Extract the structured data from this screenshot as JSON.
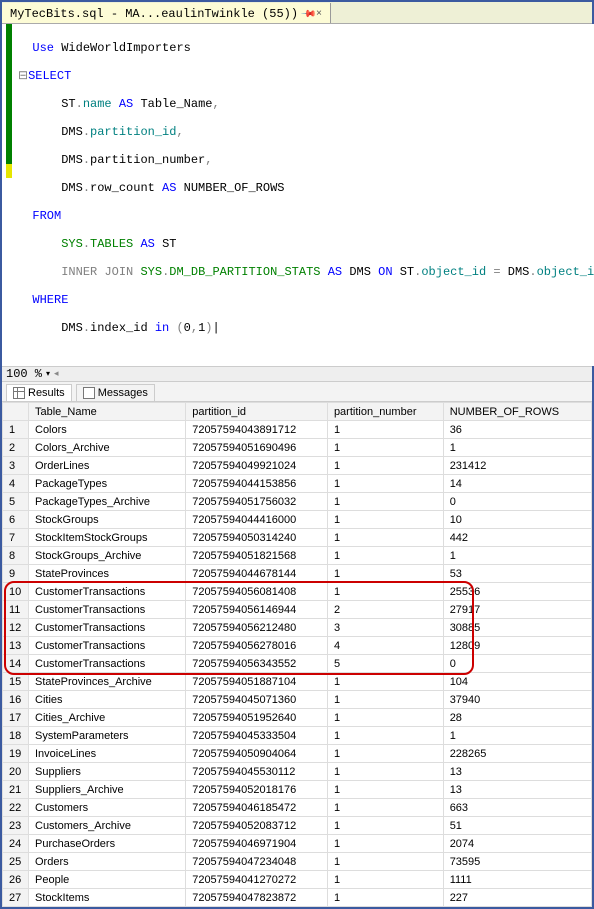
{
  "tab": {
    "title": "MyTecBits.sql - MA...eaulinTwinkle (55))",
    "close": "×"
  },
  "zoom": {
    "value": "100 %"
  },
  "result_tabs": {
    "results": "Results",
    "messages": "Messages"
  },
  "sql": {
    "l1_use": "Use",
    "l1_db": "WideWorldImporters",
    "l2_select": "SELECT",
    "l3_alias": "ST",
    "l3_dot": ".",
    "l3_name": "name",
    "l3_as": "AS",
    "l3_tbl": "Table_Name",
    "l3_c": ",",
    "l4_alias": "DMS",
    "l4_col": "partition_id",
    "l5_alias": "DMS",
    "l5_col": "partition_number",
    "l6_alias": "DMS",
    "l6_col": "row_count",
    "l6_as": "AS",
    "l6_lbl": "NUMBER_OF_ROWS",
    "l7_from": "FROM",
    "l8_sys": "SYS",
    "l8_tables": "TABLES",
    "l8_as": "AS",
    "l8_st": "ST",
    "l9_ij": "INNER",
    "l9_jn": "JOIN",
    "l9_sys": "SYS",
    "l9_stats": "DM_DB_PARTITION_STATS",
    "l9_as": "AS",
    "l9_dms": "DMS",
    "l9_on": "ON",
    "l9_st": "ST",
    "l9_obj": "object_id",
    "l9_eq": "=",
    "l9_dms2": "DMS",
    "l9_obj2": "object_id",
    "l10_where": "WHERE",
    "l11_dms": "DMS",
    "l11_col": "index_id",
    "l11_in": "in",
    "l11_par": "(",
    "l11_v0": "0",
    "l11_c": ",",
    "l11_v1": "1",
    "l11_parc": ")"
  },
  "headers": {
    "c0": "",
    "c1": "Table_Name",
    "c2": "partition_id",
    "c3": "partition_number",
    "c4": "NUMBER_OF_ROWS"
  },
  "rows": [
    {
      "n": "1",
      "t": "Colors",
      "p": "72057594043891712",
      "pn": "1",
      "r": "36"
    },
    {
      "n": "2",
      "t": "Colors_Archive",
      "p": "72057594051690496",
      "pn": "1",
      "r": "1"
    },
    {
      "n": "3",
      "t": "OrderLines",
      "p": "72057594049921024",
      "pn": "1",
      "r": "231412"
    },
    {
      "n": "4",
      "t": "PackageTypes",
      "p": "72057594044153856",
      "pn": "1",
      "r": "14"
    },
    {
      "n": "5",
      "t": "PackageTypes_Archive",
      "p": "72057594051756032",
      "pn": "1",
      "r": "0"
    },
    {
      "n": "6",
      "t": "StockGroups",
      "p": "72057594044416000",
      "pn": "1",
      "r": "10"
    },
    {
      "n": "7",
      "t": "StockItemStockGroups",
      "p": "72057594050314240",
      "pn": "1",
      "r": "442"
    },
    {
      "n": "8",
      "t": "StockGroups_Archive",
      "p": "72057594051821568",
      "pn": "1",
      "r": "1"
    },
    {
      "n": "9",
      "t": "StateProvinces",
      "p": "72057594044678144",
      "pn": "1",
      "r": "53"
    },
    {
      "n": "10",
      "t": "CustomerTransactions",
      "p": "72057594056081408",
      "pn": "1",
      "r": "25536"
    },
    {
      "n": "11",
      "t": "CustomerTransactions",
      "p": "72057594056146944",
      "pn": "2",
      "r": "27917"
    },
    {
      "n": "12",
      "t": "CustomerTransactions",
      "p": "72057594056212480",
      "pn": "3",
      "r": "30885"
    },
    {
      "n": "13",
      "t": "CustomerTransactions",
      "p": "72057594056278016",
      "pn": "4",
      "r": "12809"
    },
    {
      "n": "14",
      "t": "CustomerTransactions",
      "p": "72057594056343552",
      "pn": "5",
      "r": "0"
    },
    {
      "n": "15",
      "t": "StateProvinces_Archive",
      "p": "72057594051887104",
      "pn": "1",
      "r": "104"
    },
    {
      "n": "16",
      "t": "Cities",
      "p": "72057594045071360",
      "pn": "1",
      "r": "37940"
    },
    {
      "n": "17",
      "t": "Cities_Archive",
      "p": "72057594051952640",
      "pn": "1",
      "r": "28"
    },
    {
      "n": "18",
      "t": "SystemParameters",
      "p": "72057594045333504",
      "pn": "1",
      "r": "1"
    },
    {
      "n": "19",
      "t": "InvoiceLines",
      "p": "72057594050904064",
      "pn": "1",
      "r": "228265"
    },
    {
      "n": "20",
      "t": "Suppliers",
      "p": "72057594045530112",
      "pn": "1",
      "r": "13"
    },
    {
      "n": "21",
      "t": "Suppliers_Archive",
      "p": "72057594052018176",
      "pn": "1",
      "r": "13"
    },
    {
      "n": "22",
      "t": "Customers",
      "p": "72057594046185472",
      "pn": "1",
      "r": "663"
    },
    {
      "n": "23",
      "t": "Customers_Archive",
      "p": "72057594052083712",
      "pn": "1",
      "r": "51"
    },
    {
      "n": "24",
      "t": "PurchaseOrders",
      "p": "72057594046971904",
      "pn": "1",
      "r": "2074"
    },
    {
      "n": "25",
      "t": "Orders",
      "p": "72057594047234048",
      "pn": "1",
      "r": "73595"
    },
    {
      "n": "26",
      "t": "People",
      "p": "72057594041270272",
      "pn": "1",
      "r": "1111"
    },
    {
      "n": "27",
      "t": "StockItems",
      "p": "72057594047823872",
      "pn": "1",
      "r": "227"
    }
  ]
}
